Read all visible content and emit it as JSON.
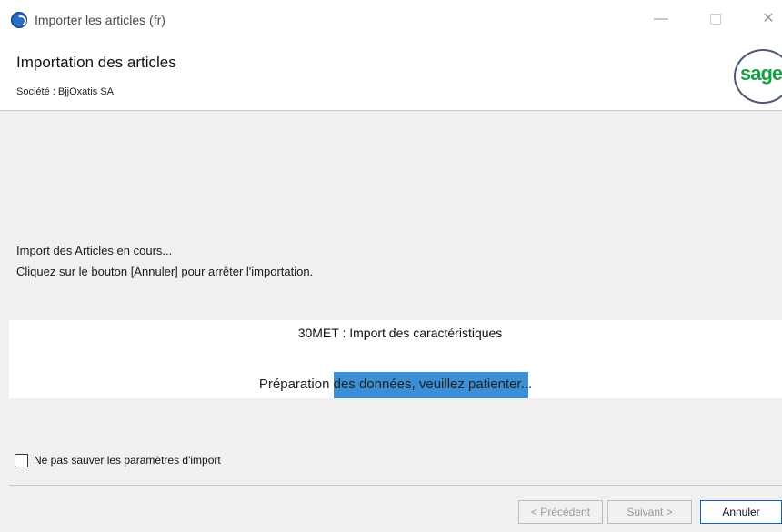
{
  "window": {
    "title": "Importer les articles (fr)",
    "minimize_glyph": "—",
    "close_glyph": "✕"
  },
  "header": {
    "title": "Importation des articles",
    "subtitle": "Société : BjjOxatis SA",
    "logo_text": "sage"
  },
  "message": {
    "line1": "Import des Articles en cours...",
    "line2": "Cliquez sur le bouton [Annuler] pour arrêter l'importation."
  },
  "progress": {
    "title": "30MET : Import des caractéristiques",
    "status": "Préparation des données, veuillez patienter...",
    "fill_color": "#3c8fd4"
  },
  "options": {
    "no_save_label": "Ne pas sauver les paramètres d'import",
    "no_save_checked": false
  },
  "buttons": {
    "prev_label": "< Précédent",
    "next_label": "Suivant >",
    "cancel_label": "Annuler"
  },
  "colors": {
    "logo_green": "#1ba04a",
    "accent_blue": "#0a62c8"
  }
}
